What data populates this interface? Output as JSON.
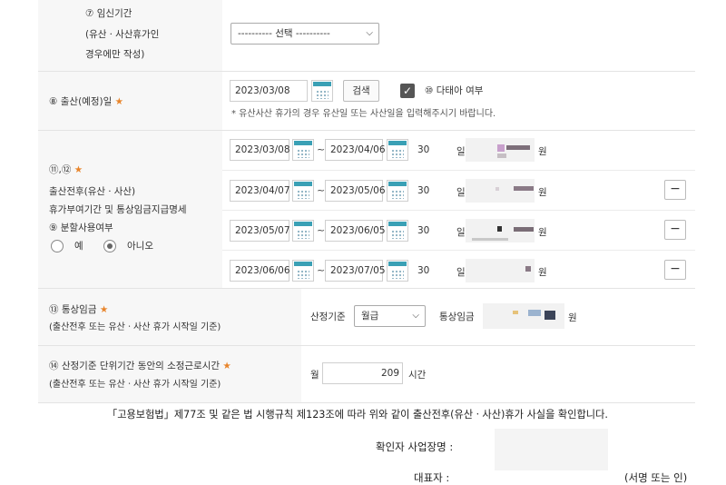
{
  "pregnancy": {
    "label_line1": "⑦ 임신기간",
    "label_line2": "(유산ㆍ사산휴가인",
    "label_line3": "경우에만 작성)",
    "select_value": "---------- 선택 ----------"
  },
  "birth": {
    "label": "⑧ 출산(예정)일",
    "star": "★",
    "date_value": "2023/03/08",
    "search_button": "검색",
    "twins_label": "⑩ 다태아 여부",
    "note": "* 유산사산 휴가의 경우 유산일 또는 사산일을 입력해주시기 바랍니다."
  },
  "leave": {
    "label_num": "⑪,⑫",
    "star": "★",
    "label_line1": "출산전후(유산ㆍ사산)",
    "label_line2": "휴가부여기간 및 통상임금지급명세",
    "split_label": "⑨ 분할사용여부",
    "radio_yes": "예",
    "radio_no": "아니오",
    "tilde": "~",
    "day_unit": "일",
    "won_unit": "원",
    "rows": [
      {
        "start": "2023/03/08",
        "end": "2023/04/06",
        "days": "30"
      },
      {
        "start": "2023/04/07",
        "end": "2023/05/06",
        "days": "30"
      },
      {
        "start": "2023/05/07",
        "end": "2023/06/05",
        "days": "30"
      },
      {
        "start": "2023/06/06",
        "end": "2023/07/05",
        "days": "30"
      }
    ],
    "minus_symbol": "−"
  },
  "wage": {
    "label_line1": "⑬ 통상임금",
    "star": "★",
    "label_line2": "(출산전후 또는 유산ㆍ사산 휴가 시작일 기준)",
    "basis_label": "산정기준",
    "basis_value": "월급",
    "wage_label": "통상임금",
    "won_unit": "원"
  },
  "hours": {
    "label_line1": "⑭ 산정기준 단위기간 동안의 소정근로시간",
    "star": "★",
    "label_line2": "(출산전후 또는 유산ㆍ사산 휴가 시작일 기준)",
    "prefix": "월",
    "value": "209",
    "unit": "시간"
  },
  "footer": {
    "statement": "「고용보험법」제77조 및 같은 법 시행규칙 제123조에 따라 위와 같이 출산전후(유산ㆍ사산)휴가 사실을 확인합니다.",
    "business_label": "확인자 사업장명 :",
    "rep_label": "대표자 :",
    "signature": "(서명 또는 인)"
  },
  "colors": {
    "accent": "#e8842a",
    "calendar": "#3aa0b5"
  }
}
